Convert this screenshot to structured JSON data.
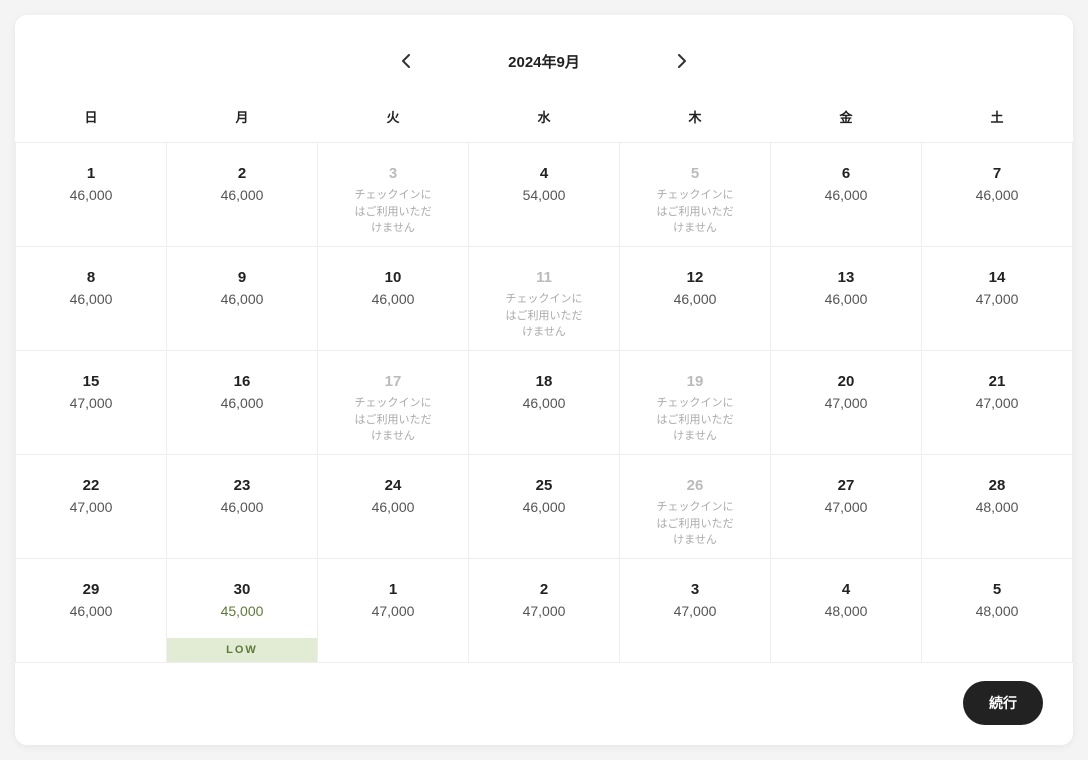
{
  "header": {
    "month_label": "2024年9月"
  },
  "weekdays": [
    "日",
    "月",
    "火",
    "水",
    "木",
    "金",
    "土"
  ],
  "unavailable_text": "チェックインに\nはご利用いただ\nけません",
  "low_label": "LOW",
  "continue_label": "続行",
  "weeks": [
    [
      {
        "d": "1",
        "p": "46,000"
      },
      {
        "d": "2",
        "p": "46,000"
      },
      {
        "d": "3",
        "unavail": true
      },
      {
        "d": "4",
        "p": "54,000"
      },
      {
        "d": "5",
        "unavail": true
      },
      {
        "d": "6",
        "p": "46,000"
      },
      {
        "d": "7",
        "p": "46,000"
      }
    ],
    [
      {
        "d": "8",
        "p": "46,000"
      },
      {
        "d": "9",
        "p": "46,000"
      },
      {
        "d": "10",
        "p": "46,000"
      },
      {
        "d": "11",
        "unavail": true
      },
      {
        "d": "12",
        "p": "46,000"
      },
      {
        "d": "13",
        "p": "46,000"
      },
      {
        "d": "14",
        "p": "47,000"
      }
    ],
    [
      {
        "d": "15",
        "p": "47,000"
      },
      {
        "d": "16",
        "p": "46,000"
      },
      {
        "d": "17",
        "unavail": true
      },
      {
        "d": "18",
        "p": "46,000"
      },
      {
        "d": "19",
        "unavail": true
      },
      {
        "d": "20",
        "p": "47,000"
      },
      {
        "d": "21",
        "p": "47,000"
      }
    ],
    [
      {
        "d": "22",
        "p": "47,000"
      },
      {
        "d": "23",
        "p": "46,000"
      },
      {
        "d": "24",
        "p": "46,000"
      },
      {
        "d": "25",
        "p": "46,000"
      },
      {
        "d": "26",
        "unavail": true
      },
      {
        "d": "27",
        "p": "47,000"
      },
      {
        "d": "28",
        "p": "48,000"
      }
    ],
    [
      {
        "d": "29",
        "p": "46,000"
      },
      {
        "d": "30",
        "p": "45,000",
        "low": true
      },
      {
        "d": "1",
        "p": "47,000"
      },
      {
        "d": "2",
        "p": "47,000"
      },
      {
        "d": "3",
        "p": "47,000"
      },
      {
        "d": "4",
        "p": "48,000"
      },
      {
        "d": "5",
        "p": "48,000"
      }
    ]
  ]
}
